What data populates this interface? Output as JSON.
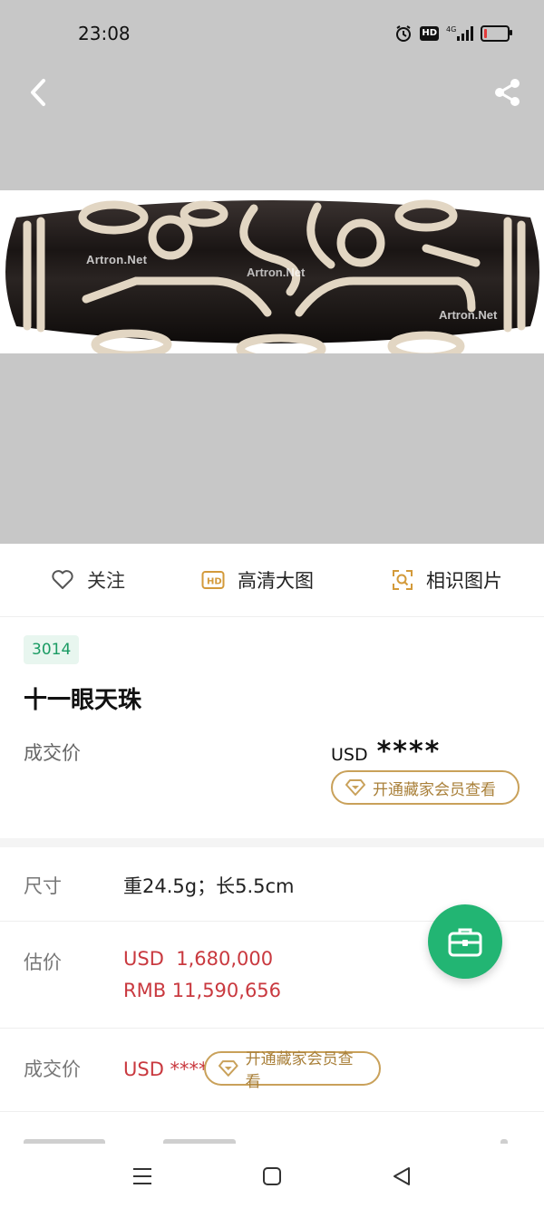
{
  "status_bar": {
    "time": "23:08",
    "hd_badge": "HD",
    "network": "4G",
    "icons": [
      "alarm-icon",
      "hd-icon",
      "signal-4g-icon",
      "battery-low-icon"
    ]
  },
  "hero": {
    "background": "#c7c7c7",
    "watermark": "Artron.Net",
    "icons": [
      "back-chevron-icon",
      "share-icon"
    ]
  },
  "actions": {
    "follow_label": "关注",
    "hd_label": "高清大图",
    "hd_badge": "HD",
    "similar_label": "相识图片"
  },
  "lot": {
    "number": "3014",
    "title": "十一眼天珠",
    "deal_label": "成交价",
    "deal_currency": "USD",
    "deal_masked": "****",
    "vip_button": "开通藏家会员查看"
  },
  "details": {
    "size_label": "尺寸",
    "size_value": "重24.5g；长5.5cm",
    "estimate_label": "估价",
    "estimate_usd": "USD  1,680,000",
    "estimate_rmb": "RMB 11,590,656",
    "deal_label": "成交价",
    "deal_value": "USD ****",
    "vip_button": "开通藏家会员查看"
  },
  "colors": {
    "accent_green": "#22b573",
    "price_red": "#c9393f",
    "gold": "#c9a15a",
    "lot_badge_bg": "#e8f6ef",
    "lot_badge_text": "#1a9b63"
  },
  "fab": {
    "icon": "briefcase-icon"
  },
  "nav": {
    "icons": [
      "menu-icon",
      "home-square-icon",
      "back-triangle-icon"
    ]
  }
}
